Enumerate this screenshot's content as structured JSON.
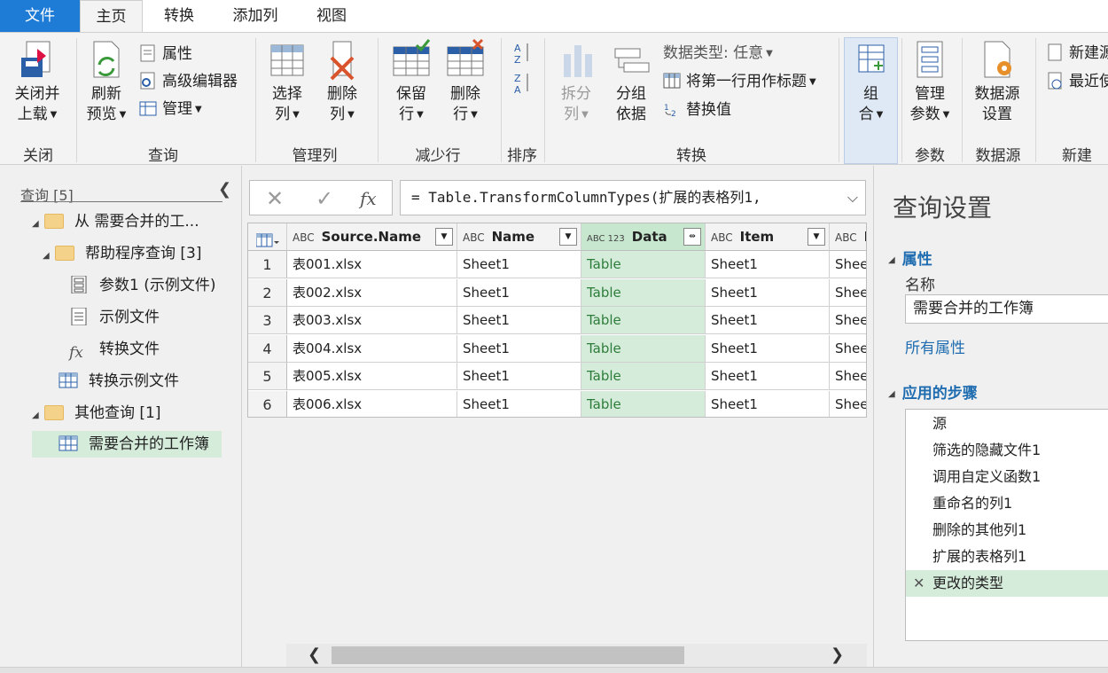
{
  "tabs": [
    "文件",
    "主页",
    "转换",
    "添加列",
    "视图"
  ],
  "ribbon": {
    "groups": {
      "close": "关闭",
      "query": "查询",
      "manage_cols": "管理列",
      "reduce_rows": "减少行",
      "sort": "排序",
      "transform": "转换",
      "params": "参数",
      "datasource": "数据源",
      "new": "新建"
    },
    "close_load": [
      "关闭并",
      "上载"
    ],
    "refresh": [
      "刷新",
      "预览"
    ],
    "properties": "属性",
    "advanced_editor": "高级编辑器",
    "manage": "管理",
    "choose_cols": [
      "选择",
      "列"
    ],
    "remove_cols": [
      "删除",
      "列"
    ],
    "keep_rows": [
      "保留",
      "行"
    ],
    "remove_rows": [
      "删除",
      "行"
    ],
    "split": [
      "拆分",
      "列"
    ],
    "group_by": [
      "分组",
      "依据"
    ],
    "data_type": "数据类型: 任意",
    "first_row_header": "将第一行用作标题",
    "replace_values": "替换值",
    "combine": [
      "组",
      "合"
    ],
    "manage_params": [
      "管理",
      "参数"
    ],
    "ds_settings": [
      "数据源",
      "设置"
    ],
    "new_source": "新建源",
    "recent_source": "最近使"
  },
  "queries": {
    "header": "查询 [5]",
    "tree": {
      "root_folder": "从 需要合并的工...",
      "helper_folder": "帮助程序查询 [3]",
      "param1": "参数1 (示例文件)",
      "sample_file": "示例文件",
      "transform_file": "转换文件",
      "transform_sample": "转换示例文件",
      "other_folder": "其他查询 [1]",
      "workbook": "需要合并的工作簿"
    }
  },
  "formula": {
    "text": "= Table.TransformColumnTypes(扩展的表格列1,"
  },
  "grid": {
    "columns": [
      {
        "type": "ABC",
        "name": "Source.Name"
      },
      {
        "type": "ABC",
        "name": "Name"
      },
      {
        "type": "ABC 123",
        "name": "Data"
      },
      {
        "type": "ABC",
        "name": "Item"
      },
      {
        "type": "ABC",
        "name": "K"
      }
    ],
    "rows": [
      {
        "n": "1",
        "cells": [
          "表001.xlsx",
          "Sheet1",
          "Table",
          "Sheet1",
          "Sheet"
        ]
      },
      {
        "n": "2",
        "cells": [
          "表002.xlsx",
          "Sheet1",
          "Table",
          "Sheet1",
          "Sheet"
        ]
      },
      {
        "n": "3",
        "cells": [
          "表003.xlsx",
          "Sheet1",
          "Table",
          "Sheet1",
          "Sheet"
        ]
      },
      {
        "n": "4",
        "cells": [
          "表004.xlsx",
          "Sheet1",
          "Table",
          "Sheet1",
          "Sheet"
        ]
      },
      {
        "n": "5",
        "cells": [
          "表005.xlsx",
          "Sheet1",
          "Table",
          "Sheet1",
          "Sheet"
        ]
      },
      {
        "n": "6",
        "cells": [
          "表006.xlsx",
          "Sheet1",
          "Table",
          "Sheet1",
          "Sheet"
        ]
      }
    ]
  },
  "settings": {
    "title": "查询设置",
    "properties": "属性",
    "name_label": "名称",
    "name_value": "需要合并的工作簿",
    "all_properties": "所有属性",
    "applied_steps": "应用的步骤",
    "steps": [
      "源",
      "筛选的隐藏文件1",
      "调用自定义函数1",
      "重命名的列1",
      "删除的其他列1",
      "扩展的表格列1",
      "更改的类型"
    ]
  },
  "colors": {
    "file_tab": "#1e7bd6",
    "accent_blue": "#1f6db0",
    "selected_green": "#d6ecdb"
  }
}
